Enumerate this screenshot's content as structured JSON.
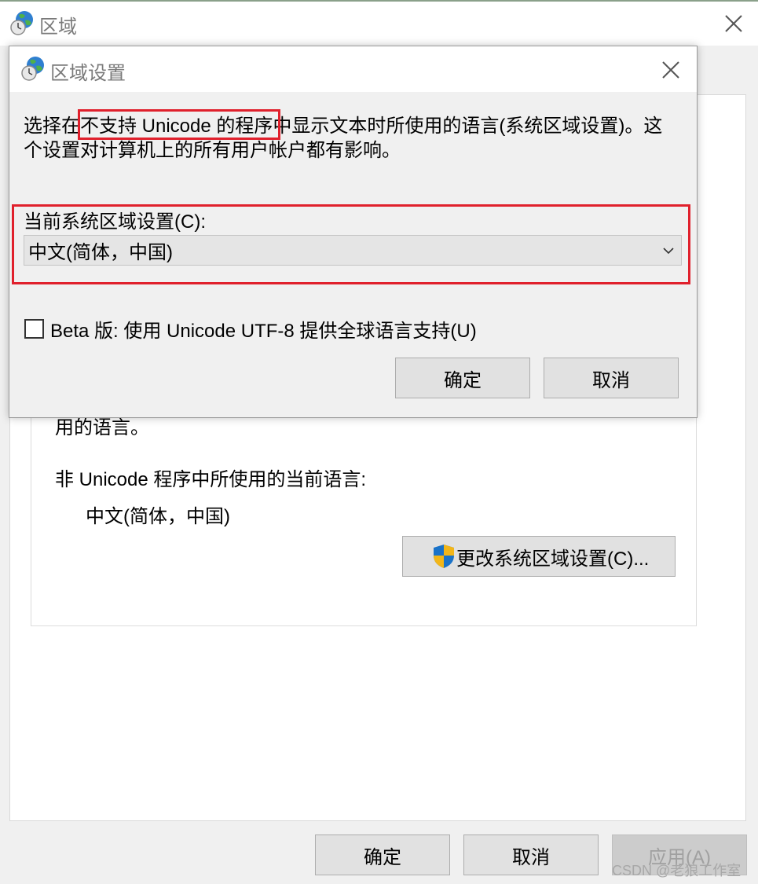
{
  "parent": {
    "title": "区域",
    "cut_text": "用的语言。",
    "current_lang_label": "非 Unicode 程序中所使用的当前语言:",
    "current_lang_value": "中文(简体，中国)",
    "change_locale_button": "更改系统区域设置(C)...",
    "ok_button": "确定",
    "cancel_button": "取消",
    "apply_button": "应用(A)",
    "watermark": "CSDN @老狼工作室"
  },
  "dialog": {
    "title": "区域设置",
    "description_line1": "选择在不支持 Unicode 的程序中显示文本时所使用的语言(系统区域设置)。这",
    "description_line2": "个设置对计算机上的所有用户帐户都有影响。",
    "locale_label": "当前系统区域设置(C):",
    "locale_value": "中文(简体，中国)",
    "beta_label": "Beta 版: 使用 Unicode UTF-8 提供全球语言支持(U)",
    "beta_checked": false,
    "ok_button": "确定",
    "cancel_button": "取消"
  },
  "colors": {
    "highlight": "#e0202c",
    "shield_blue": "#1a73c9",
    "shield_yellow": "#f2b619"
  },
  "icons": {
    "title": "globe-clock-icon",
    "close": "close-icon",
    "shield": "shield-icon",
    "dropdown": "chevron-down-icon"
  }
}
